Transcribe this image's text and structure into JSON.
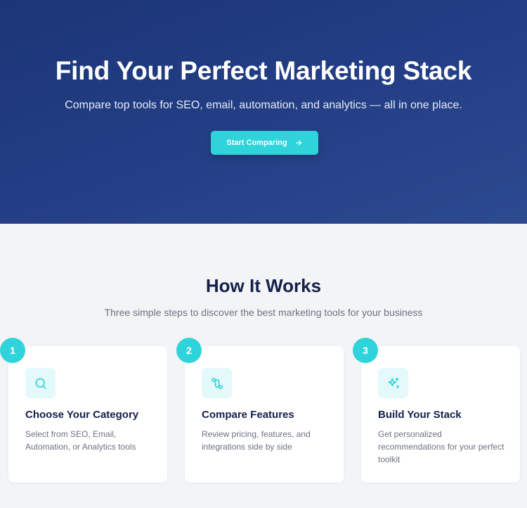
{
  "hero": {
    "title": "Find Your Perfect Marketing Stack",
    "subtitle": "Compare top tools for SEO, email, automation, and analytics — all in one place.",
    "cta_label": "Start Comparing",
    "cta_icon": "arrow-right-icon"
  },
  "how": {
    "title": "How It Works",
    "subtitle": "Three simple steps to discover the best marketing tools for your business",
    "steps": [
      {
        "number": "1",
        "icon": "search-icon",
        "title": "Choose Your Category",
        "description": "Select from SEO, Email, Automation, or Analytics tools"
      },
      {
        "number": "2",
        "icon": "git-compare-icon",
        "title": "Compare Features",
        "description": "Review pricing, features, and integrations side by side"
      },
      {
        "number": "3",
        "icon": "sparkles-icon",
        "title": "Build Your Stack",
        "description": "Get personalized recommendations for your perfect toolkit"
      }
    ]
  },
  "colors": {
    "accent": "#2fd4da",
    "hero_bg": "#1f3a80",
    "heading": "#14204a",
    "muted_text": "#6b7280",
    "section_bg": "#f3f4f6"
  }
}
